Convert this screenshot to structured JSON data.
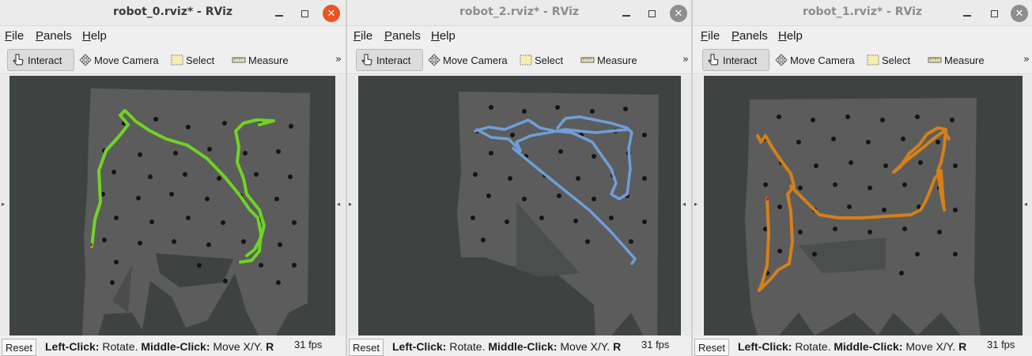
{
  "windows": [
    {
      "title": "robot_0.rviz* - RViz",
      "active": true,
      "menu": [
        "File",
        "Panels",
        "Help"
      ],
      "tools": [
        "Interact",
        "Move Camera",
        "Select",
        "Measure"
      ],
      "more": "»",
      "reset": "Reset",
      "hint_left": "Left-Click:",
      "hint_rotate": " Rotate. ",
      "hint_middle": "Middle-Click:",
      "hint_move": " Move X/Y. ",
      "hint_r": "R",
      "fps": "31 fps",
      "path_color": "#6fd424"
    },
    {
      "title": "robot_2.rviz* - RViz",
      "active": false,
      "menu": [
        "File",
        "Panels",
        "Help"
      ],
      "tools": [
        "Interact",
        "Move Camera",
        "Select",
        "Measure"
      ],
      "more": "»",
      "reset": "Reset",
      "hint_left": "Left-Click:",
      "hint_rotate": " Rotate. ",
      "hint_middle": "Middle-Click:",
      "hint_move": " Move X/Y. ",
      "hint_r": "R",
      "fps": "31 fps",
      "path_color": "#6f9fd6"
    },
    {
      "title": "robot_1.rviz* - RViz",
      "active": false,
      "menu": [
        "File",
        "Panels",
        "Help"
      ],
      "tools": [
        "Interact",
        "Move Camera",
        "Select",
        "Measure"
      ],
      "more": "»",
      "reset": "Reset",
      "hint_left": "Left-Click:",
      "hint_rotate": " Rotate. ",
      "hint_middle": "Middle-Click:",
      "hint_move": " Move X/Y. ",
      "hint_r": "R",
      "fps": "31 fps",
      "path_color": "#d4801a"
    }
  ],
  "icons": {
    "interact": "pointing-hand-icon",
    "move_camera": "move-arrows-icon",
    "select": "selection-box-icon",
    "measure": "ruler-icon"
  },
  "colors": {
    "map_free": "#5c5c5c",
    "map_unknown": "#3e4342",
    "obstacle": "#151515",
    "close_active": "#e95420"
  }
}
